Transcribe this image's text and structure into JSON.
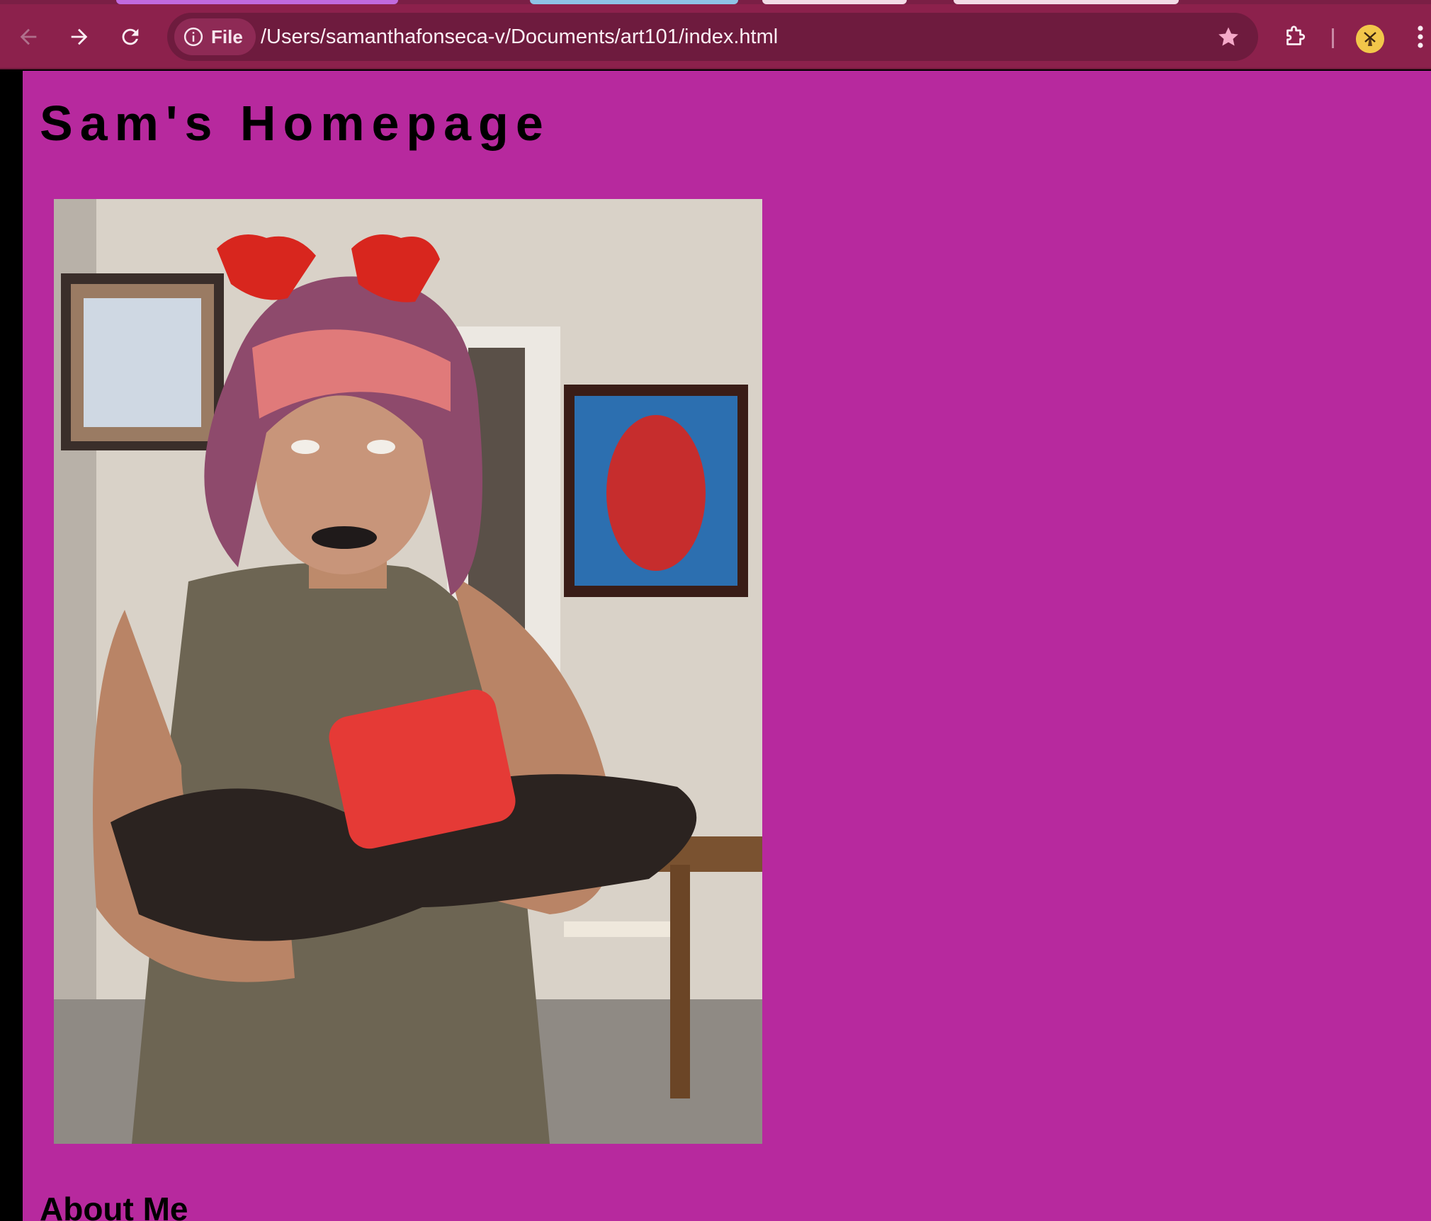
{
  "browser": {
    "site_chip_label": "File",
    "url": "/Users/samanthafonseca-v/Documents/art101/index.html",
    "icons": {
      "back": "back-arrow-icon",
      "forward": "forward-arrow-icon",
      "reload": "reload-icon",
      "site_info": "info-icon",
      "bookmark": "star-icon",
      "extensions": "puzzle-piece-icon",
      "menu": "kebab-menu-icon"
    },
    "colors": {
      "frame": "#8c214c",
      "omnibox": "#6e1b3e",
      "bookmark_star": "#f4a9c8"
    }
  },
  "page": {
    "title": "Sam's Homepage",
    "about_heading": "About Me",
    "background_color": "#b7299e"
  }
}
